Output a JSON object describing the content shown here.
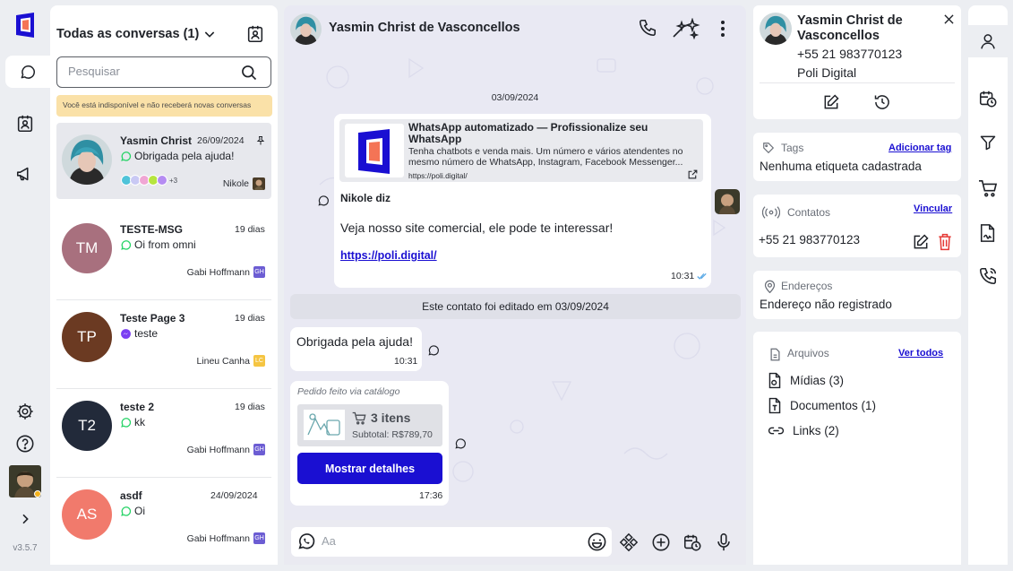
{
  "app": {
    "version": "v3.5.7"
  },
  "colors": {
    "accent": "#1a0fd2",
    "notice_bg": "#fae1a8",
    "whatsapp": "#25d366",
    "messenger": "#7b3ff2",
    "delete": "#e53935"
  },
  "nav": {
    "items": [
      {
        "name": "chat-icon",
        "active": true
      },
      {
        "name": "contacts-icon"
      },
      {
        "name": "megaphone-icon"
      }
    ],
    "bottom": [
      {
        "name": "gear-icon"
      },
      {
        "name": "help-icon"
      },
      {
        "name": "expand-chevron-icon"
      }
    ]
  },
  "conv_list": {
    "title": "Todas as conversas (1)",
    "search_placeholder": "Pesquisar",
    "notice": "Você está indisponível e não receberá novas conversas",
    "items": [
      {
        "name": "Yasmin Christ",
        "time": "26/09/2024",
        "channel": "whatsapp",
        "message": "Obrigada pela ajuda!",
        "agent": "Nikole",
        "agent_tag": "",
        "more_tags": "+3",
        "selected": true,
        "avatar": "photo",
        "color": "#7aa7b0"
      },
      {
        "name": "TESTE-MSG",
        "time": "19 dias",
        "channel": "whatsapp",
        "message": "Oi from omni",
        "agent": "Gabi Hoffmann",
        "agent_tag": "GH",
        "initials": "TM",
        "color": "#a8707e",
        "tag_color": "#6c5dd3"
      },
      {
        "name": "Teste Page 3",
        "time": "19 dias",
        "channel": "messenger",
        "message": "teste",
        "agent": "Lineu Canha",
        "agent_tag": "LC",
        "initials": "TP",
        "color": "#6b3a22",
        "tag_color": "#f5c542"
      },
      {
        "name": "teste 2",
        "time": "19 dias",
        "channel": "whatsapp",
        "message": "kk",
        "agent": "Gabi Hoffmann",
        "agent_tag": "GH",
        "initials": "T2",
        "color": "#222a3a",
        "tag_color": "#6c5dd3"
      },
      {
        "name": "asdf",
        "time": "24/09/2024",
        "channel": "whatsapp",
        "message": "Oi",
        "agent": "Gabi Hoffmann",
        "agent_tag": "GH",
        "initials": "AS",
        "color": "#f17a6c",
        "tag_color": "#6c5dd3"
      }
    ]
  },
  "chat": {
    "contact_name": "Yasmin Christ de Vasconcellos",
    "date_label": "03/09/2024",
    "link_message": {
      "preview_title": "WhatsApp automatizado — Profissionalize seu WhatsApp",
      "preview_desc": "Tenha chatbots e venda mais. Um número e vários atendentes no mesmo número de WhatsApp, Instagram, Facebook Messenger...",
      "preview_url": "https://poli.digital/",
      "author": "Nikole diz",
      "text": "Veja nosso site comercial, ele pode te interessar!",
      "link": "https://poli.digital/",
      "time": "10:31"
    },
    "system_message": "Este contato foi editado em 03/09/2024",
    "incoming": {
      "text": "Obrigada pela ajuda!",
      "time": "10:31"
    },
    "order": {
      "label": "Pedido feito via catálogo",
      "items": "3 itens",
      "subtotal": "Subtotal: R$789,70",
      "button": "Mostrar detalhes",
      "time": "17:36"
    },
    "composer_placeholder": "Aa"
  },
  "contact": {
    "name": "Yasmin Christ de Vasconcellos",
    "phone": "+55 21 983770123",
    "company": "Poli Digital",
    "tags": {
      "title": "Tags",
      "action": "Adicionar tag",
      "empty": "Nenhuma etiqueta cadastrada"
    },
    "contacts": {
      "title": "Contatos",
      "action": "Vincular",
      "phone": "+55 21 983770123"
    },
    "address": {
      "title": "Endereços",
      "empty": "Endereço não registrado"
    },
    "files": {
      "title": "Arquivos",
      "action": "Ver todos",
      "media": "Mídias (3)",
      "documents": "Documentos (1)",
      "links": "Links (2)"
    }
  }
}
